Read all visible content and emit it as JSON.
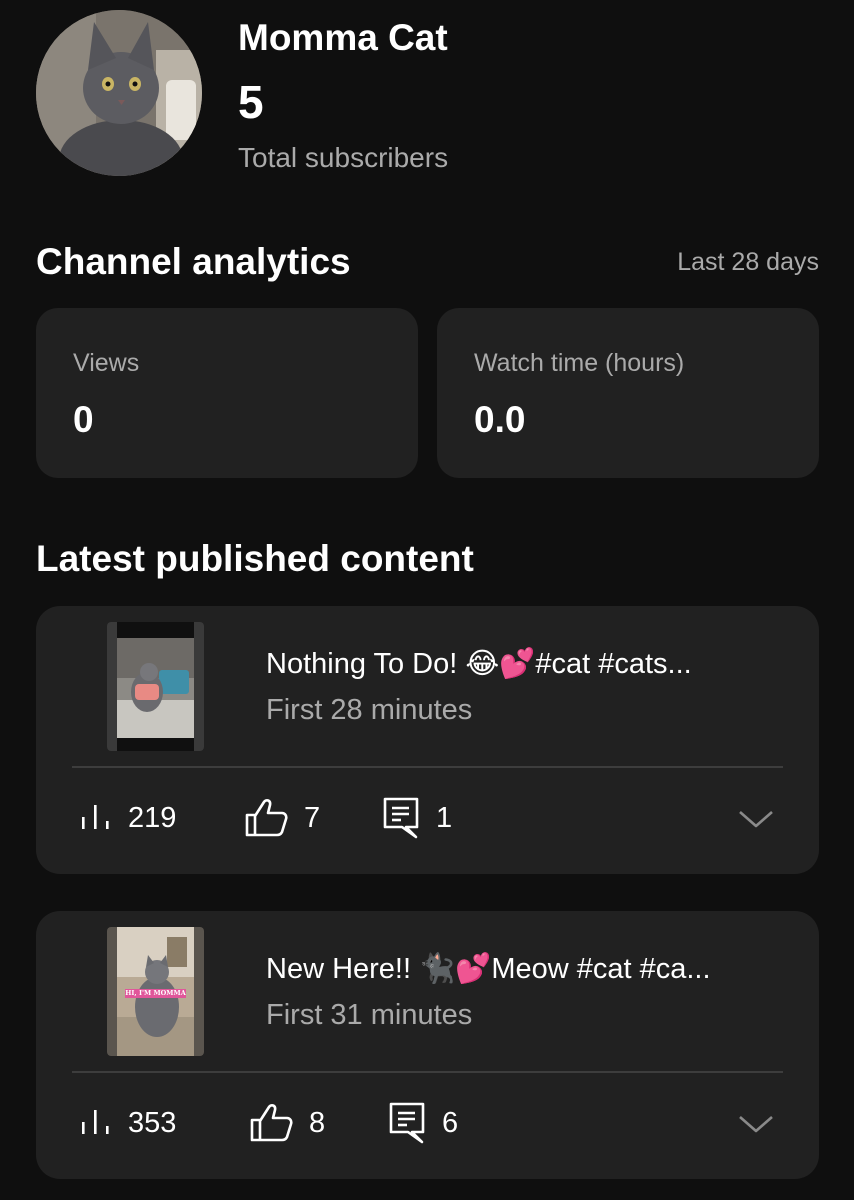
{
  "channel": {
    "name": "Momma Cat",
    "subscriber_count": "5",
    "subscriber_label": "Total subscribers",
    "avatar_icon": "cat-photo-avatar"
  },
  "analytics": {
    "title": "Channel analytics",
    "period": "Last 28 days",
    "cards": [
      {
        "label": "Views",
        "value": "0"
      },
      {
        "label": "Watch time (hours)",
        "value": "0.0"
      }
    ]
  },
  "latest": {
    "title": "Latest published content",
    "items": [
      {
        "title": "Nothing To Do! 😂💕#cat #cats...",
        "subtitle": "First 28 minutes",
        "views": "219",
        "likes": "7",
        "comments": "1"
      },
      {
        "title": "New Here!! 🐈‍⬛💕Meow #cat #ca...",
        "subtitle": "First 31 minutes",
        "views": "353",
        "likes": "8",
        "comments": "6",
        "thumbnail_text": "HI, I'M MOMMA"
      }
    ]
  },
  "colors": {
    "background": "#0f0f0f",
    "card": "#212121",
    "secondary_text": "#aaaaaa",
    "divider": "#3d3d3d"
  }
}
